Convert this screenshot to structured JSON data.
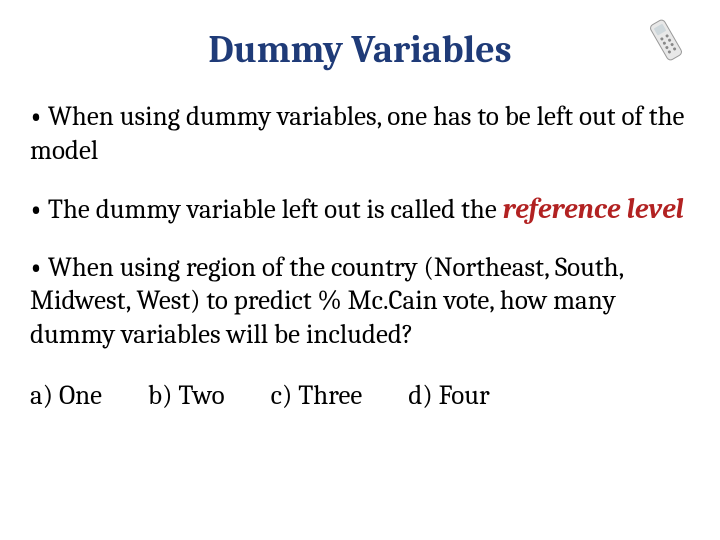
{
  "title": "Dummy Variables",
  "bullet1": "When using dummy variables, one has to be left out of the model",
  "bullet2_prefix": "The dummy variable left out is called the ",
  "bullet2_emph": "reference level",
  "bullet3": "When using region of the country (Northeast, South, Midwest, West) to predict % Mc.Cain vote, how many dummy variables will be included?",
  "choices": {
    "a": "a)  One",
    "b": "b) Two",
    "c": "c) Three",
    "d": "d) Four"
  }
}
